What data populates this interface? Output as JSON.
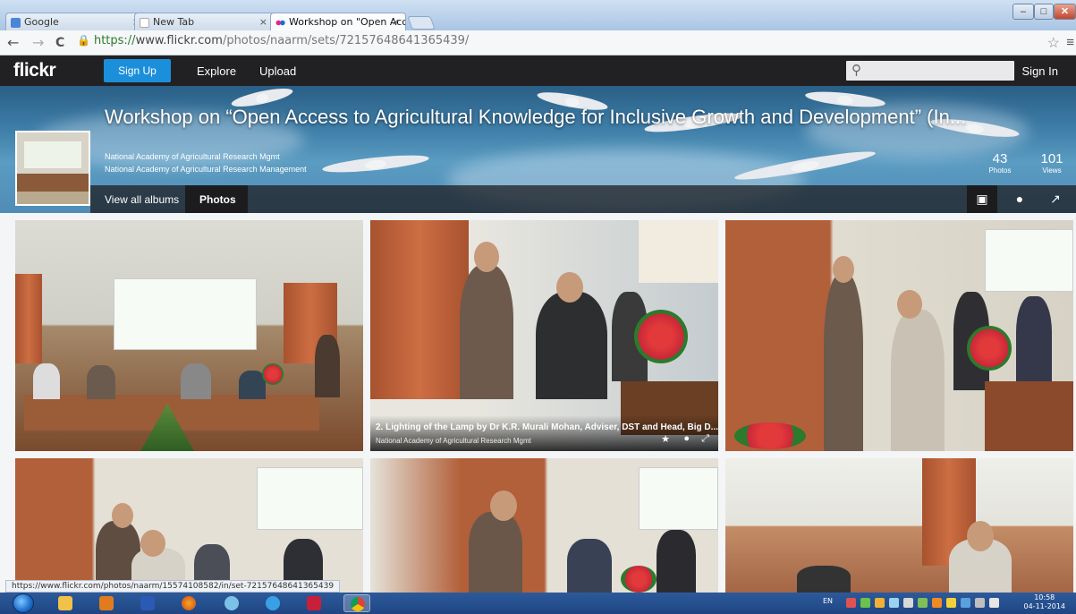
{
  "browser": {
    "tabs": [
      {
        "label": "Google",
        "close": "×",
        "favicon_color": "#4a86d6"
      },
      {
        "label": "New Tab",
        "close": "×",
        "favicon_color": "#ffffff"
      },
      {
        "label": "Workshop on \"Open Acce",
        "close": "×",
        "favicon_color": "#e0288c"
      }
    ],
    "window_controls": {
      "minimize": "–",
      "maximize": "□",
      "close": "✕"
    },
    "nav": {
      "back": "←",
      "forward": "→",
      "reload": "C"
    },
    "url_scheme": "https://",
    "url_host": "www.flickr.com",
    "url_path": "/photos/naarm/sets/72157648641365439/",
    "bookmark_star": "☆",
    "menu_icon": "≡",
    "status_url": "https://www.flickr.com/photos/naarm/15574108582/in/set-72157648641365439"
  },
  "flickr": {
    "logo": "flickr",
    "signup": "Sign Up",
    "explore": "Explore",
    "upload": "Upload",
    "search_placeholder": "",
    "signin": "Sign In"
  },
  "album": {
    "title": "Workshop on “Open Access to Agricultural Knowledge for Inclusive Growth and Development” (In...",
    "owner": "National Academy of Agricultural Research Mgmt",
    "owner_full": "National Academy of Agricultural Research Management",
    "photos_count": "43",
    "photos_label": "Photos",
    "views_count": "101",
    "views_label": "Views",
    "tab_all": "View all albums",
    "tab_photos": "Photos"
  },
  "photos": [
    {
      "id": 1
    },
    {
      "id": 2,
      "caption": "2. Lighting of the Lamp by Dr K.R. Murali Mohan, Adviser, DST and Head, Big D...",
      "owner": "National Academy of Agricultural Research Mgmt",
      "icons": [
        "★",
        "●",
        "⤢"
      ]
    },
    {
      "id": 3
    },
    {
      "id": 4
    },
    {
      "id": 5
    },
    {
      "id": 6
    }
  ],
  "taskbar": {
    "lang": "EN",
    "time": "10:58",
    "date": "04-11-2014"
  }
}
